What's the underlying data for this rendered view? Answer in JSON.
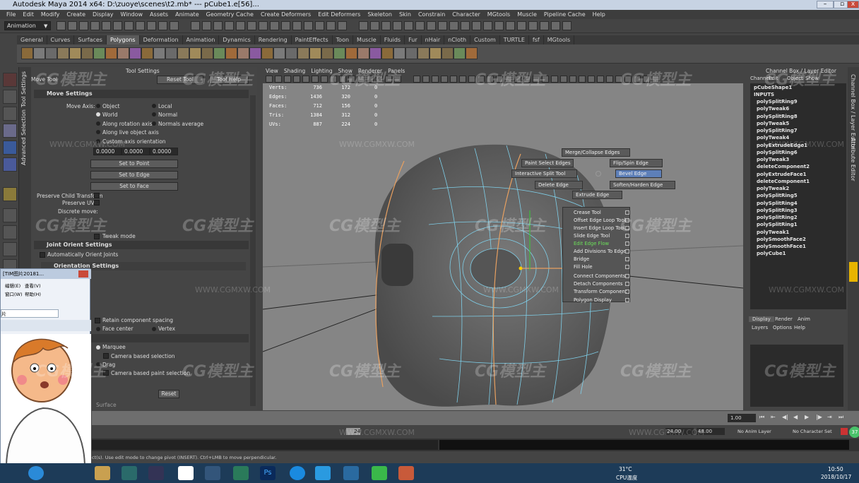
{
  "window": {
    "title": "Autodesk Maya 2014 x64: D:\\zuoye\\scenes\\t2.mb*   ---   pCube1.e[56]..."
  },
  "menu": [
    "File",
    "Edit",
    "Modify",
    "Create",
    "Display",
    "Window",
    "Assets",
    "Animate",
    "Geometry Cache",
    "Create Deformers",
    "Edit Deformers",
    "Skeleton",
    "Skin",
    "Constrain",
    "Character",
    "MGtools",
    "Muscle",
    "Pipeline Cache",
    "Help"
  ],
  "status": {
    "mode": "Animation"
  },
  "shelf_tabs": [
    "General",
    "Curves",
    "Surfaces",
    "Polygons",
    "Deformation",
    "Animation",
    "Dynamics",
    "Rendering",
    "PaintEffects",
    "Toon",
    "Muscle",
    "Fluids",
    "Fur",
    "nHair",
    "nCloth",
    "Custom",
    "TURTLE",
    "fsf",
    "MGtools"
  ],
  "shelf_active": "Polygons",
  "side_tabs": [
    "Tool Settings",
    "Advanced Selection"
  ],
  "tool_settings": {
    "header": "Tool Settings",
    "tool_name": "Move Tool",
    "reset": "Reset Tool",
    "help": "Tool Help",
    "move_settings": "Move Settings",
    "move_axis": "Move Axis:",
    "axis_options": [
      "Object",
      "Local",
      "World",
      "Normal",
      "Along rotation axis",
      "Normals average",
      "Along live object axis",
      "Custom axis orientation"
    ],
    "xyz": [
      "0.0000",
      "0.0000",
      "0.0000"
    ],
    "set_point": "Set to Point",
    "set_edge": "Set to Edge",
    "set_face": "Set to Face",
    "preserve_child": "Preserve Child Transform",
    "preserve_uvs": "Preserve UVs",
    "discrete_move": "Discrete move:",
    "tweak_mode": "Tweak mode",
    "joint_orient": "Joint Orient Settings",
    "auto_orient": "Automatically Orient Joints",
    "orientation_settings": "Orientation Settings",
    "retain_spacing": "Retain component spacing",
    "face_center": "Face center",
    "vertex": "Vertex",
    "options": "Options",
    "marquee": "Marquee",
    "camera_sel": "Camera based selection",
    "drag": "Drag",
    "camera_paint": "Camera based paint selection",
    "reset_btn": "Reset",
    "surface": "Surface"
  },
  "viewport": {
    "menu": [
      "View",
      "Shading",
      "Lighting",
      "Show",
      "Renderer",
      "Panels"
    ],
    "hud": [
      {
        "label": "Verts:",
        "a": "736",
        "b": "172",
        "c": "0"
      },
      {
        "label": "Edges:",
        "a": "1436",
        "b": "320",
        "c": "0"
      },
      {
        "label": "Faces:",
        "a": "712",
        "b": "156",
        "c": "0"
      },
      {
        "label": "Tris:",
        "a": "1384",
        "b": "312",
        "c": "0"
      },
      {
        "label": "UVs:",
        "a": "887",
        "b": "224",
        "c": "0"
      }
    ]
  },
  "marking_menu": {
    "merge": "Merge/Collapse Edges",
    "paint": "Paint Select Edges",
    "flip": "Flip/Spin Edge",
    "split": "Interactive Split Tool",
    "bevel": "Bevel Edge",
    "delete": "Delete Edge",
    "soften": "Soften/Harden Edge",
    "extrude": "Extrude Edge",
    "list": [
      "Crease Tool",
      "Offset Edge Loop Tool",
      "Insert Edge Loop Tool",
      "Slide Edge Tool",
      "Edit Edge Flow",
      "Add Divisions To Edge",
      "Bridge",
      "Fill Hole",
      "Connect Components",
      "Detach Components",
      "Transform Component",
      "Polygon Display"
    ]
  },
  "channel_box": {
    "title": "Channel Box / Layer Editor",
    "menu": [
      "Channels",
      "Edit",
      "Object",
      "Show"
    ],
    "shape": "pCubeShape1",
    "inputs": "INPUTS",
    "history": [
      "polySplitRing9",
      "polyTweak6",
      "polySplitRing8",
      "polyTweak5",
      "polySplitRing7",
      "polyTweak4",
      "polyExtrudeEdge1",
      "polySplitRing6",
      "polyTweak3",
      "deleteComponent2",
      "polyExtrudeFace1",
      "deleteComponent1",
      "polyTweak2",
      "polySplitRing5",
      "polySplitRing4",
      "polySplitRing3",
      "polySplitRing2",
      "polySplitRing1",
      "polyTweak1",
      "polySmoothFace2",
      "polySmoothFace1",
      "polyCube1"
    ]
  },
  "layer_editor": {
    "tabs": [
      "Display",
      "Render",
      "Anim"
    ],
    "menu": [
      "Layers",
      "Options",
      "Help"
    ]
  },
  "right_tabs": [
    "Channel Box / Layer Editor",
    "Attribute Editor"
  ],
  "timeline": {
    "current": "1.00",
    "frame": "24",
    "start": "24.00",
    "end": "48.00",
    "anim_layer": "No Anim Layer",
    "character_set": "No Character Set"
  },
  "help_line": "ct(s). Use edit mode to change pivot (INSERT). Ctrl+LMB to move perpendicular.",
  "overlay": {
    "title": "[TIM图片20181...",
    "menu": [
      "编辑(E)",
      "查看(V)",
      "窗口(W)",
      "帮助(H)"
    ],
    "file": "片20181017093926.jpg"
  },
  "taskbar": {
    "temp": "31°C",
    "temp_label": "CPU温度",
    "time": "10:50",
    "date": "2018/10/17",
    "badge": "37"
  },
  "watermark": {
    "site": "WWW.CGMXW.COM",
    "brand": "CG模型主"
  }
}
